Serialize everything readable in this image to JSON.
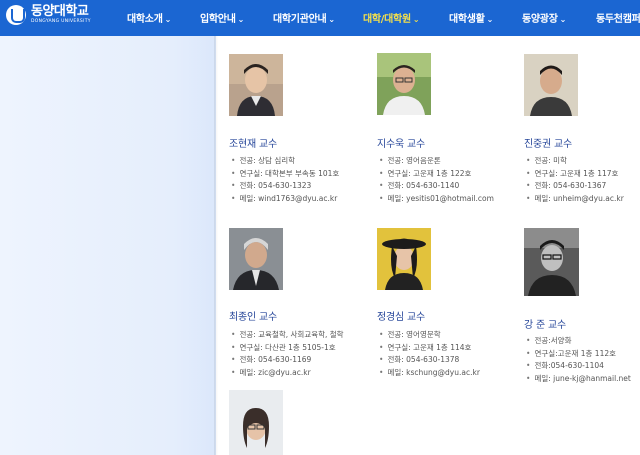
{
  "header": {
    "logo_ko": "동양대학교",
    "logo_en": "DONGYANG UNIVERSITY",
    "nav": [
      {
        "label": "대학소개",
        "active": false
      },
      {
        "label": "입학안내",
        "active": false
      },
      {
        "label": "대학기관안내",
        "active": false
      },
      {
        "label": "대학/대학원",
        "active": true
      },
      {
        "label": "대학생활",
        "active": false
      },
      {
        "label": "동양광장",
        "active": false
      },
      {
        "label": "동두천캠퍼",
        "active": false
      }
    ]
  },
  "professors": [
    {
      "name": "조현재 교수",
      "major": "전공: 상담 심리학",
      "office": "연구실: 대학본부 부속동 101호",
      "phone": "전화: 054-630-1323",
      "email": "메일: wind1763@dyu.ac.kr"
    },
    {
      "name": "지수욱 교수",
      "major": "전공: 영어음운론",
      "office": "연구실: 고운재 1층 122호",
      "phone": "전화: 054-630-1140",
      "email": "메일: yesitis01@hotmail.com"
    },
    {
      "name": "진중권 교수",
      "major": "전공: 미학",
      "office": "연구실: 고운재 1층 117호",
      "phone": "전화: 054-630-1367",
      "email": "메일: unheim@dyu.ac.kr"
    },
    {
      "name": "최종인 교수",
      "major": "전공: 교육철학, 사회교육학, 철학",
      "office": "연구실: 다산관 1층 5105-1호",
      "phone": "전화: 054-630-1169",
      "email": "메일: zic@dyu.ac.kr"
    },
    {
      "name": "정경심 교수",
      "major": "전공: 영어영문학",
      "office": "연구실: 고운재 1층 114호",
      "phone": "전화: 054-630-1378",
      "email": "메일: kschung@dyu.ac.kr"
    },
    {
      "name": "강 준 교수",
      "major": "전공:서양화",
      "office": "연구실:고운재 1층 112호",
      "phone": "전화:054-630-1104",
      "email": "메일: june-kj@hanmail.net"
    }
  ]
}
